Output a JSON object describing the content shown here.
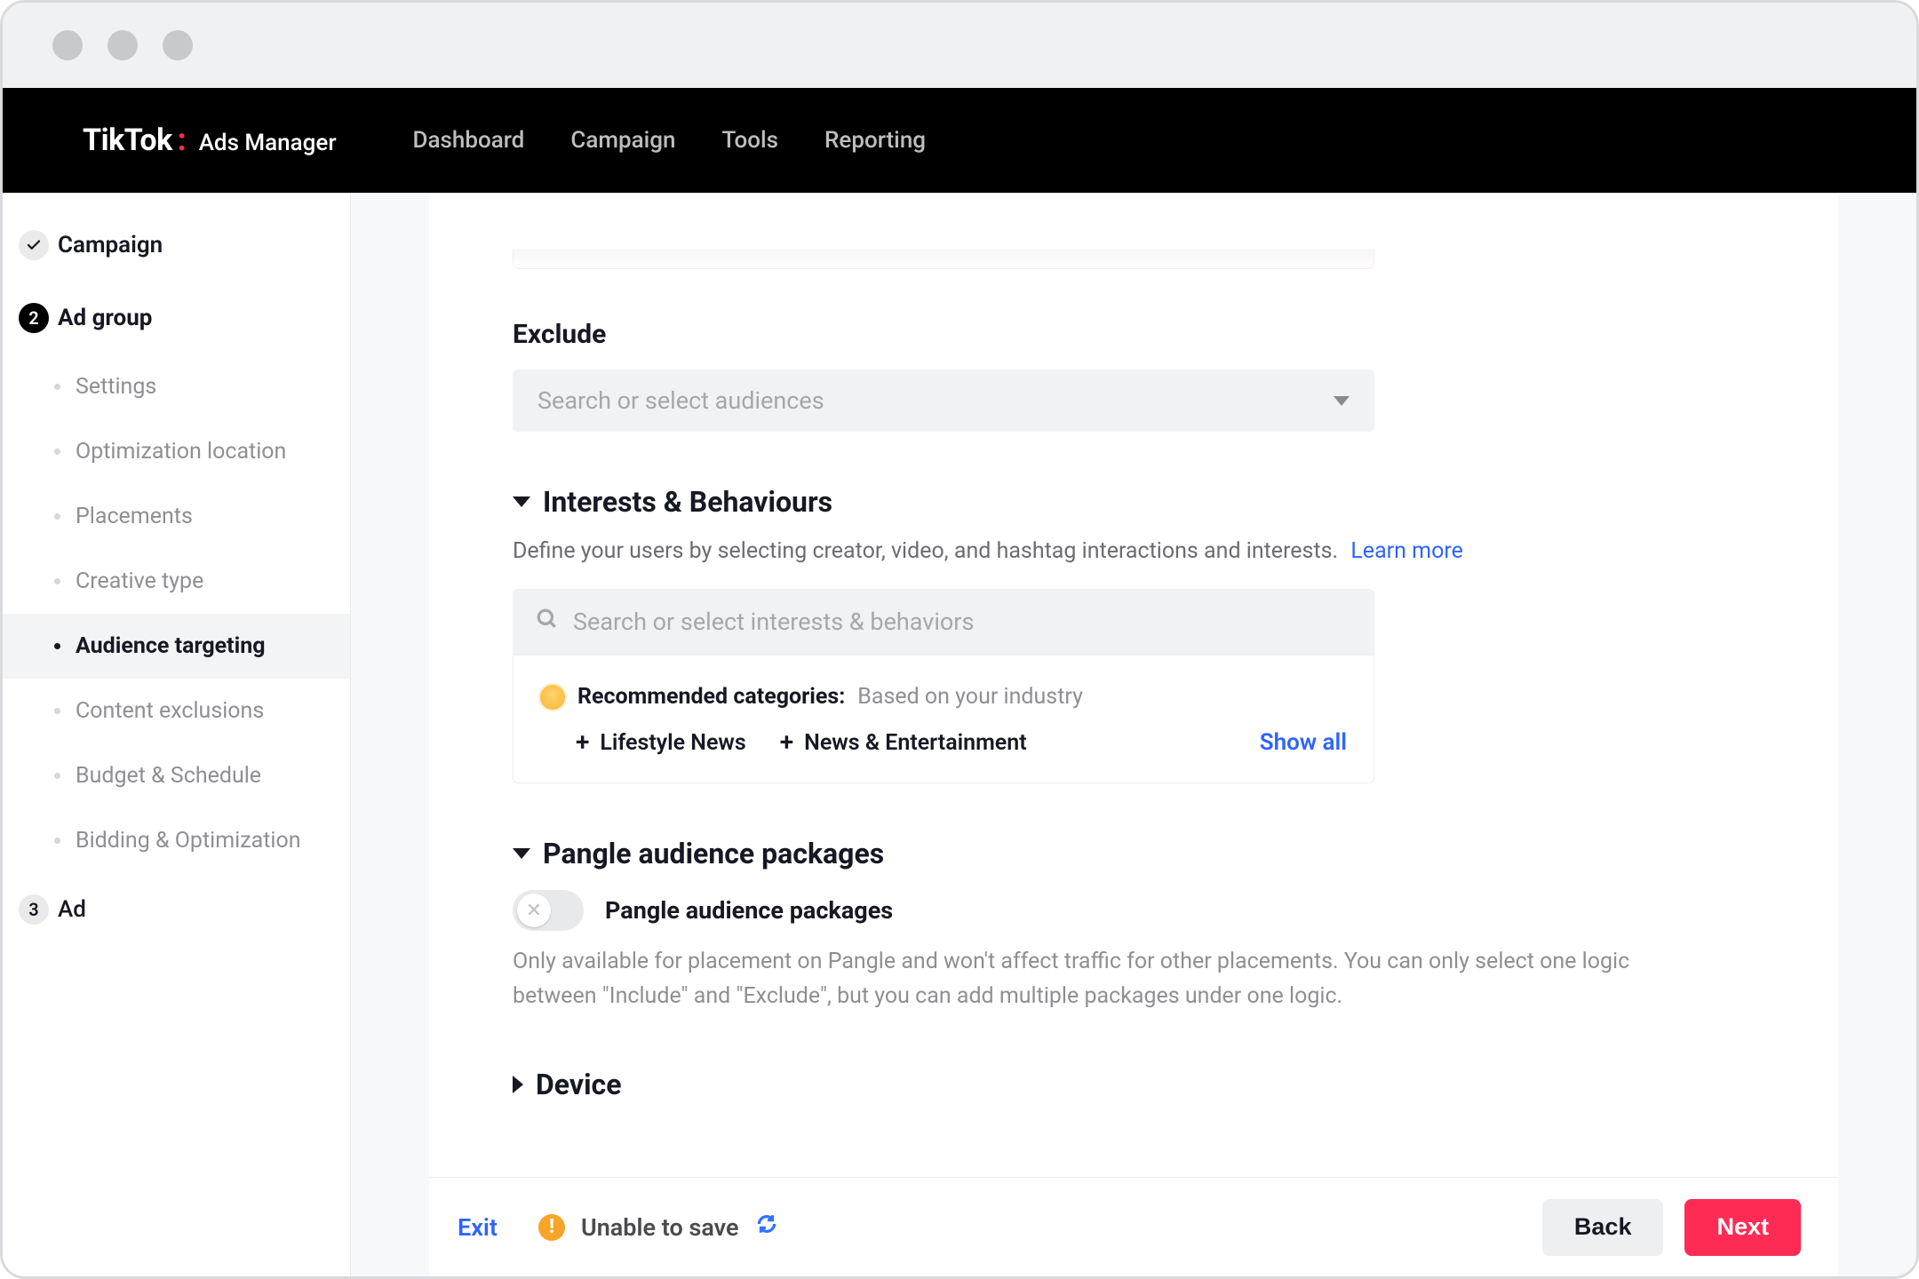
{
  "brand": {
    "logo": "TikTok",
    "sub": "Ads Manager"
  },
  "header": {
    "nav": [
      "Dashboard",
      "Campaign",
      "Tools",
      "Reporting"
    ]
  },
  "sidebar": {
    "steps": {
      "campaign": "Campaign",
      "adgroup": "Ad group",
      "ad": "Ad",
      "ad_number": "3",
      "adgroup_number": "2"
    },
    "substeps": [
      "Settings",
      "Optimization location",
      "Placements",
      "Creative type",
      "Audience targeting",
      "Content exclusions",
      "Budget & Schedule",
      "Bidding & Optimization"
    ],
    "active_substep_index": 4
  },
  "content": {
    "exclude": {
      "label": "Exclude",
      "placeholder": "Search or select audiences"
    },
    "interests": {
      "title": "Interests & Behaviours",
      "desc": "Define your users by selecting creator, video, and hashtag interactions and interests.",
      "learn_more": "Learn more",
      "search_placeholder": "Search or select interests & behaviors",
      "rec_label": "Recommended categories:",
      "rec_sub": "Based on your industry",
      "chips": [
        "Lifestyle News",
        "News & Entertainment"
      ],
      "show_all": "Show all"
    },
    "pangle": {
      "title": "Pangle audience packages",
      "toggle_label": "Pangle audience packages",
      "desc": "Only available for placement on Pangle and won't affect traffic for other placements. You can only select one logic between \"Include\" and \"Exclude\", but you can add multiple packages under one logic."
    },
    "device": {
      "title": "Device"
    }
  },
  "footer": {
    "exit": "Exit",
    "status": "Unable to save",
    "back": "Back",
    "next": "Next"
  }
}
